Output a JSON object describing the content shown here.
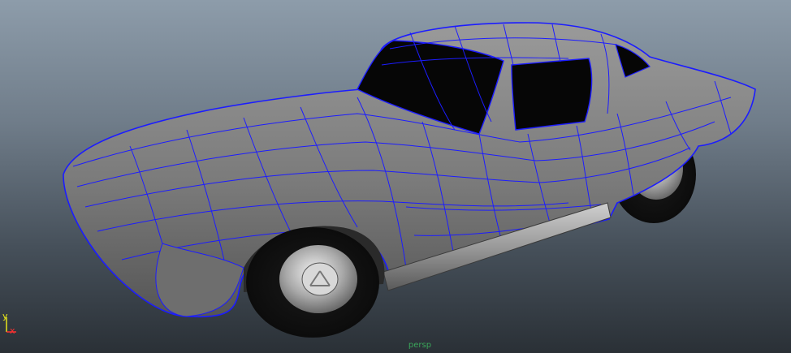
{
  "viewport": {
    "camera_name": "persp",
    "background_top": "#8d9caa",
    "background_bottom": "#2a3036"
  },
  "axis_gizmo": {
    "y_label": "y",
    "x_label": "x",
    "y_color": "#e7e61b",
    "x_color": "#ff3030"
  },
  "model": {
    "wireframe_color": "#1c1cff",
    "surface_color": "#7f7f7f",
    "glass_color": "#050505"
  }
}
